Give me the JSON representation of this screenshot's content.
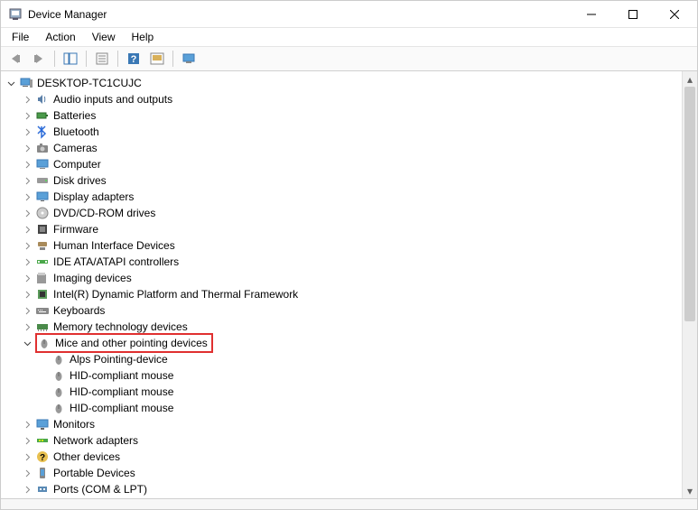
{
  "title": "Device Manager",
  "menu": {
    "file": "File",
    "action": "Action",
    "view": "View",
    "help": "Help"
  },
  "root": {
    "name": "DESKTOP-TC1CUJC"
  },
  "categories": [
    {
      "label": "Audio inputs and outputs",
      "icon": "audio",
      "expanded": false
    },
    {
      "label": "Batteries",
      "icon": "battery",
      "expanded": false
    },
    {
      "label": "Bluetooth",
      "icon": "bluetooth",
      "expanded": false
    },
    {
      "label": "Cameras",
      "icon": "camera",
      "expanded": false
    },
    {
      "label": "Computer",
      "icon": "computer",
      "expanded": false
    },
    {
      "label": "Disk drives",
      "icon": "disk",
      "expanded": false
    },
    {
      "label": "Display adapters",
      "icon": "display",
      "expanded": false
    },
    {
      "label": "DVD/CD-ROM drives",
      "icon": "dvd",
      "expanded": false
    },
    {
      "label": "Firmware",
      "icon": "firmware",
      "expanded": false
    },
    {
      "label": "Human Interface Devices",
      "icon": "hid",
      "expanded": false
    },
    {
      "label": "IDE ATA/ATAPI controllers",
      "icon": "ide",
      "expanded": false
    },
    {
      "label": "Imaging devices",
      "icon": "imaging",
      "expanded": false
    },
    {
      "label": "Intel(R) Dynamic Platform and Thermal Framework",
      "icon": "intel",
      "expanded": false
    },
    {
      "label": "Keyboards",
      "icon": "keyboard",
      "expanded": false
    },
    {
      "label": "Memory technology devices",
      "icon": "memory",
      "expanded": false
    },
    {
      "label": "Mice and other pointing devices",
      "icon": "mouse",
      "expanded": true,
      "highlighted": true,
      "children": [
        {
          "label": "Alps Pointing-device",
          "icon": "mouse"
        },
        {
          "label": "HID-compliant mouse",
          "icon": "mouse"
        },
        {
          "label": "HID-compliant mouse",
          "icon": "mouse"
        },
        {
          "label": "HID-compliant mouse",
          "icon": "mouse"
        }
      ]
    },
    {
      "label": "Monitors",
      "icon": "monitor",
      "expanded": false
    },
    {
      "label": "Network adapters",
      "icon": "network",
      "expanded": false
    },
    {
      "label": "Other devices",
      "icon": "other",
      "expanded": false
    },
    {
      "label": "Portable Devices",
      "icon": "portable",
      "expanded": false
    },
    {
      "label": "Ports (COM & LPT)",
      "icon": "ports",
      "expanded": false
    }
  ]
}
